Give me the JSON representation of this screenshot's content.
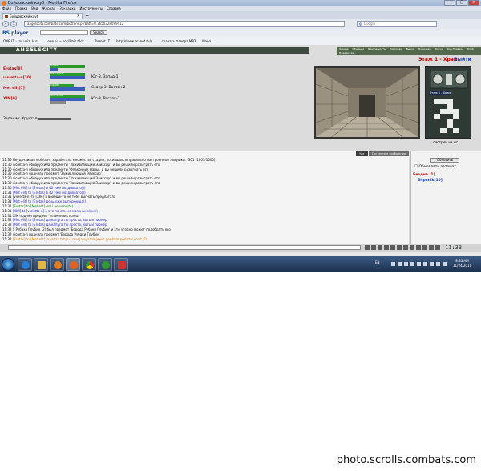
{
  "browser": {
    "window_title": "Бойцовский клуб - Mozilla Firefox",
    "menu": [
      "Файл",
      "Правка",
      "Вид",
      "Журнал",
      "Закладки",
      "Инструменты",
      "Справка"
    ],
    "tab_title": "Бойцовский клуб",
    "url": "angelscity.combats.com/buttons.pl?batt=0.3650328099412",
    "search_placeholder": "Google",
    "toolbar_brand": "BS.player",
    "toolbar_search_btn": "Search",
    "bookmarks": [
      "ONE.LT - tas veiz, kur ...",
      "one.lv — sociālais tīkls ...",
      "Torrent.LT",
      "http://www.eranet.tv/s...",
      "скачать плеера MP3",
      "Mana..."
    ]
  },
  "game": {
    "logo": "ANGELSCITY",
    "top_menu": [
      "Знание",
      "Общение",
      "Безопасность",
      "Персонаж",
      "Выход",
      "Новичкам",
      "Форум",
      "Кав.Правила",
      "Клуб",
      "Поддержка"
    ],
    "players": [
      {
        "name": "Erotas",
        "level": "[8]",
        "hp": "60/1062",
        "loc": ""
      },
      {
        "name": "violetta-n",
        "level": "[10]",
        "hp": "1063/1063",
        "loc": "Юг-8, Запад-1"
      },
      {
        "name": "Met elit",
        "level": "[7]",
        "hp": "346/985",
        "loc": "Север-3, Восток-2"
      },
      {
        "name": "XIM",
        "level": "[9]",
        "hp": "1637/1600",
        "loc": "Юг-3, Восток-1"
      }
    ],
    "task_label": "Задание: Хрусталь",
    "floor": "Этаж 1 - Храм",
    "exit": "Выйти",
    "map_label": "Этаж 1 - Храм",
    "look": "смотрим на юг",
    "chat_tabs": [
      "Чат",
      "Системные сообщения"
    ],
    "messages": [
      {
        "t": "11:30",
        "text": "Неудачливая violetta-n заработала множество ссадин, косившаяся правильно настроенные ловушки: -301 [1063/1600]",
        "cls": "sys"
      },
      {
        "t": "11:30",
        "text": "violetta-n обнаружила предметы 'Заживляющий Эликсир', и вы решили разыграть его",
        "cls": "sys"
      },
      {
        "t": "11:30",
        "text": "violetta-n обнаружила предметы 'Флакончик маны', и вы решили разыграть его",
        "cls": "sys"
      },
      {
        "t": "11:30",
        "text": "violetta-n подняла предмет 'Заживляющий Эликсир'",
        "cls": "sys"
      },
      {
        "t": "11:30",
        "text": "violetta-n обнаружила предметы 'Заживляющий Эликсир', и вы решили разыграть его",
        "cls": "sys"
      },
      {
        "t": "11:30",
        "text": "violetta-n обнаружила предметы 'Заживляющий Эликсир', и вы решили разыграть его",
        "cls": "sys"
      },
      {
        "t": "11:30",
        "text": "[Met elit] to [Erotas] в 42 уже поздновато)))",
        "cls": "priv"
      },
      {
        "t": "11:31",
        "text": "[Met elit] to [Erotas] в 42 уже поздновато)))",
        "cls": "priv"
      },
      {
        "t": "11:31",
        "text": "[violetta-n] to [XIM] я вообще-то не тебя выгнать предлагала",
        "cls": "sys"
      },
      {
        "t": "11:31",
        "text": "[Met elit] to [Erotas] дочь уже выпускница))",
        "cls": "priv"
      },
      {
        "t": "11:31",
        "text": "[Erotas] to [Met elit] vot i ne uslovite)",
        "cls": "green"
      },
      {
        "t": "11:31",
        "text": "[XIM] to [violetta-n] а это понял, не маленький же)",
        "cls": "priv"
      },
      {
        "t": "11:31",
        "text": "XIM поднял предмет 'Флакончик маны'",
        "cls": "sys"
      },
      {
        "t": "11:32",
        "text": "[Met elit] to [Erotas] да капуга ты просто, хоть и пионер",
        "cls": "priv"
      },
      {
        "t": "11:32",
        "text": "[Met elit] to [Erotas] да капуга ты просто, хоть и пионер",
        "cls": "priv"
      },
      {
        "t": "11:32",
        "text": "У Рубаха Глубин (2) был предмет 'Борода Рубаки Глубин' и кто угодно может подобрать его",
        "cls": "sys"
      },
      {
        "t": "11:32",
        "text": "violetta-n подняла предмет 'Борода Рубаки Глубин'",
        "cls": "sys"
      },
      {
        "t": "11:32",
        "text": "[Erotas] to [Met elit] ja rat za tebja u menja syn tak jewio pewkom pod stol xodit :D",
        "cls": "orange"
      }
    ],
    "sidebar": {
      "refresh": "Обновить",
      "auto": "Обновлять автомат.",
      "room": "Бездна (1)",
      "user": "Shpanik[10]"
    },
    "clock": "11:33"
  },
  "taskbar": {
    "lang": "EN",
    "time": "8:33 AM",
    "date": "11/24/2011"
  },
  "watermark": "photo.scrolls.combats.com"
}
